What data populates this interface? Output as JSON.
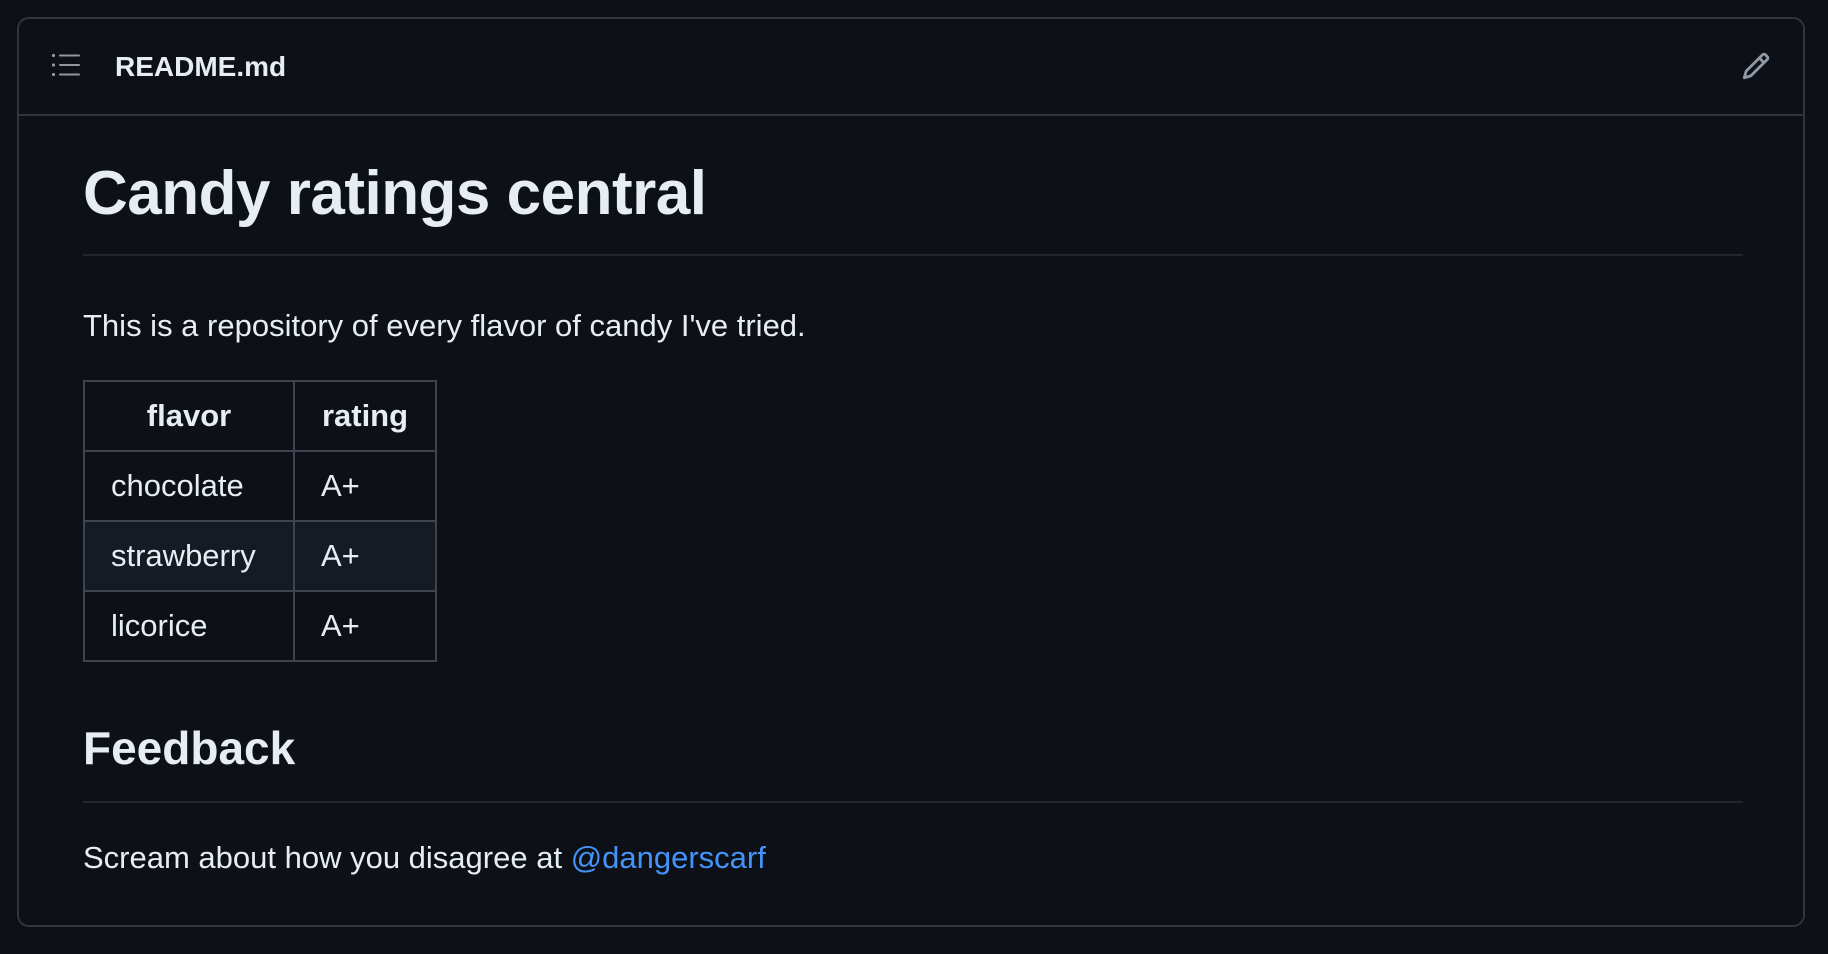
{
  "header": {
    "file_name": "README.md",
    "toc_icon": "list-unordered-icon",
    "edit_icon": "pencil-icon"
  },
  "content": {
    "title": "Candy ratings central",
    "intro": "This is a repository of every flavor of candy I've tried.",
    "table": {
      "headers": [
        "flavor",
        "rating"
      ],
      "rows": [
        [
          "chocolate",
          "A+"
        ],
        [
          "strawberry",
          "A+"
        ],
        [
          "licorice",
          "A+"
        ]
      ]
    },
    "feedback_heading": "Feedback",
    "feedback_text": "Scream about how you disagree at ",
    "feedback_mention": "@dangerscarf"
  },
  "colors": {
    "background": "#0d1117",
    "border": "#30363d",
    "text": "#e6edf3",
    "link": "#4493f8"
  }
}
